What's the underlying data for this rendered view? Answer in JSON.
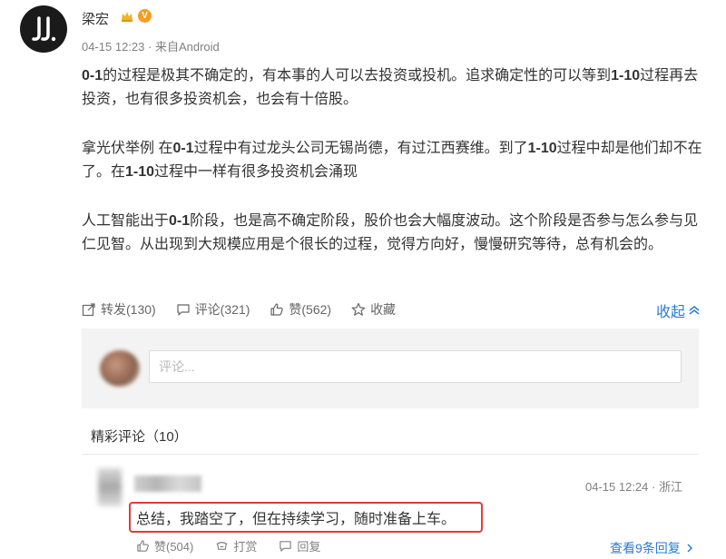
{
  "post": {
    "author": "梁宏",
    "date": "04-15 12:23",
    "source": "来自Android",
    "paragraphs": [
      {
        "parts": [
          {
            "b": "0-1"
          },
          {
            "t": "的过程是极其不确定的，有本事的人可以去投资或投机。追求确定性的可以等到"
          },
          {
            "b": "1-10"
          },
          {
            "t": "过程再去投资，也有很多投资机会，也会有十倍股。"
          }
        ]
      },
      {
        "parts": [
          {
            "t": "拿光伏举例 在"
          },
          {
            "b": "0-1"
          },
          {
            "t": "过程中有过龙头公司无锡尚德，有过江西赛维。到了"
          },
          {
            "b": "1-10"
          },
          {
            "t": "过程中却是他们却不在了。在"
          },
          {
            "b": "1-10"
          },
          {
            "t": "过程中一样有很多投资机会涌现"
          }
        ]
      },
      {
        "parts": [
          {
            "t": "人工智能出于"
          },
          {
            "b": "0-1"
          },
          {
            "t": "阶段，也是高不确定阶段，股价也会大幅度波动。这个阶段是否参与怎么参与见仁见智。从出现到大规模应用是个很长的过程，觉得方向好，慢慢研究等待，总有机会的。"
          }
        ]
      }
    ]
  },
  "actions": {
    "repost": "转发(130)",
    "comment": "评论(321)",
    "like": "赞(562)",
    "favorite": "收藏",
    "collapse": "收起"
  },
  "comment_input": {
    "placeholder": "评论..."
  },
  "comments_section": {
    "title": "精彩评论（10）",
    "items": [
      {
        "time": "04-15 12:24 · 浙江",
        "text": "总结，我踏空了，但在持续学习，随时准备上车。",
        "like": "赞(504)",
        "tip": "打赏",
        "reply": "回复",
        "more": "查看9条回复"
      }
    ]
  },
  "colors": {
    "link": "#2a7bd8",
    "highlight_border": "#e23b3b",
    "vip_badge": "#f59d22"
  },
  "icons": [
    "crown-icon",
    "verified-v-icon",
    "repost-icon",
    "comment-icon",
    "like-icon",
    "star-icon",
    "chevron-up-icon",
    "gift-icon",
    "reply-icon",
    "chevron-right-icon"
  ]
}
